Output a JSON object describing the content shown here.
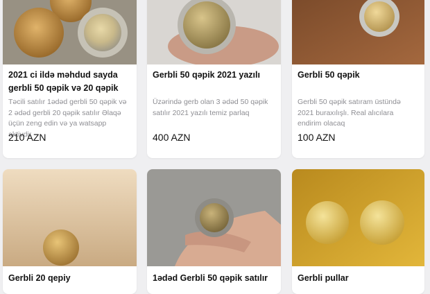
{
  "listings": [
    {
      "title": "2021 ci ildə məhdud sayda gerbli 50 qəpik və 20 qəpik",
      "description": "Təcili satılır 1ədəd gerbli 50 qəpik və 2 ədəd gerbli 20 qəpik satılır Əlaqə üçün zeng edin və ya watsapp aktivdir",
      "price": "210 AZN",
      "image": "three coins on wooden table"
    },
    {
      "title": "Gerbli 50 qəpik 2021 yazılı",
      "description": "Üzərində gerb olan 3 ədəd 50 qəpik satılır 2021 yazılı temiz parlaq",
      "price": "400 AZN",
      "image": "bimetal coin held in hand"
    },
    {
      "title": "Gerbli 50 qəpik",
      "description": "Gerbli 50 qəpik satıram üstündə 2021 buraxılışlı. Real alıcılara endirim olacaq",
      "price": "100 AZN",
      "image": "bimetal coin on wooden surface"
    },
    {
      "title": "Gerbli 20 qepiy",
      "image": "gold coin on table"
    },
    {
      "title": "1ədəd Gerbli 50 qəpik satılır",
      "image": "bimetal coin held in fingers"
    },
    {
      "title": "Gerbli pullar",
      "image": "two gold coins on yellow table"
    }
  ]
}
